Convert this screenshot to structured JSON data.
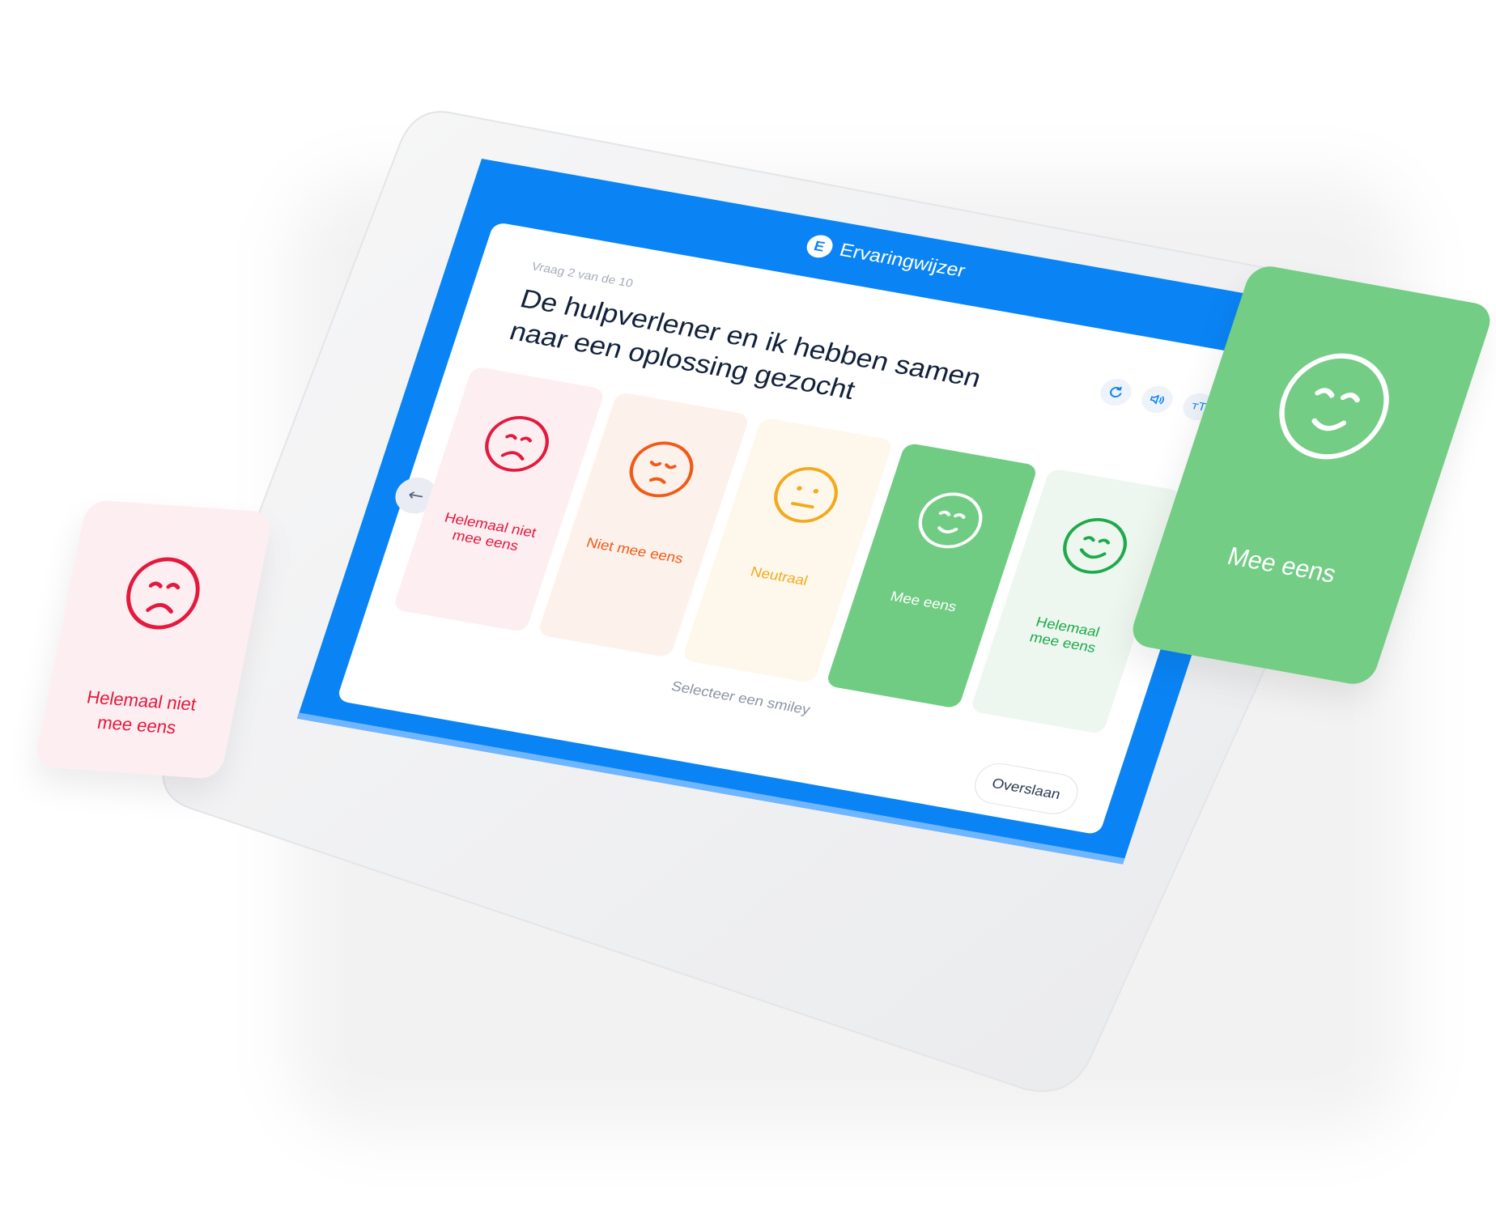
{
  "app": {
    "name": "Ervaringwijzer",
    "logo_letter": "E",
    "brand_color": "#0a84f5"
  },
  "survey": {
    "progress": "Vraag 2 van de 10",
    "question": "De hulpverlener en ik hebben samen naar een oplossing gezocht",
    "instruction": "Selecteer een smiley",
    "skip_label": "Overslaan",
    "back_icon": "arrow-left-icon",
    "tools": [
      "refresh-icon",
      "speaker-icon",
      "text-size-icon"
    ],
    "tool_text_size_glyph": "тT",
    "options": [
      {
        "label_line1": "Helemaal niet",
        "label_line2": "mee eens",
        "color": "#e3193e",
        "icon": "very-sad-face-icon"
      },
      {
        "label_line1": "Niet mee eens",
        "label_line2": "",
        "color": "#ef5b17",
        "icon": "sad-face-icon"
      },
      {
        "label_line1": "Neutraal",
        "label_line2": "",
        "color": "#f2a91d",
        "icon": "neutral-face-icon"
      },
      {
        "label_line1": "Mee eens",
        "label_line2": "",
        "color": "#70cc83",
        "icon": "smiling-face-icon",
        "selected": true
      },
      {
        "label_line1": "Helemaal",
        "label_line2": "mee eens",
        "color": "#1eaa4a",
        "icon": "very-happy-face-icon"
      }
    ]
  },
  "floating_cards": {
    "left": {
      "label_line1": "Helemaal niet",
      "label_line2": "mee eens",
      "color": "#e3193e"
    },
    "right": {
      "label": "Mee eens",
      "color": "#73cd85"
    }
  }
}
